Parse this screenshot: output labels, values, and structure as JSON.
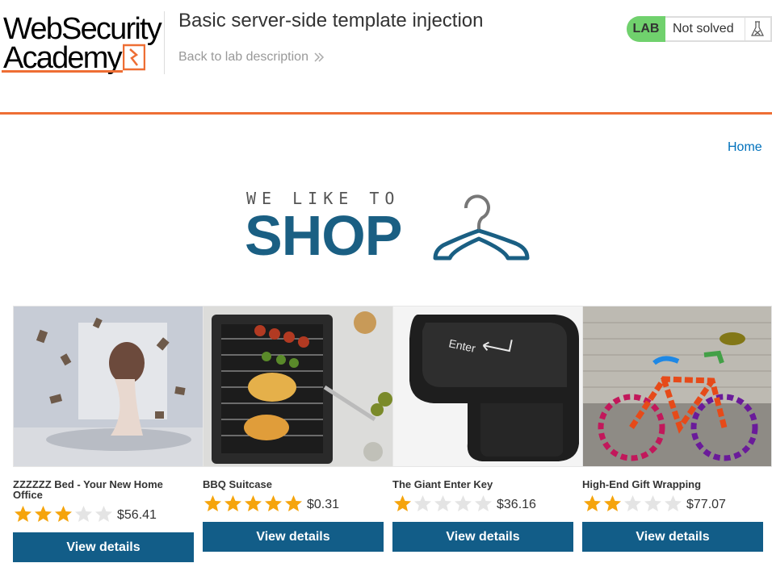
{
  "header": {
    "logo_line1": "WebSecurity",
    "logo_line2": "Academy",
    "lab_title": "Basic server-side template injection",
    "back_link": "Back to lab description",
    "status_badge": "LAB",
    "status_text": "Not solved"
  },
  "nav": {
    "home": "Home"
  },
  "banner": {
    "small": "WE LIKE TO",
    "big": "SHOP"
  },
  "products": [
    {
      "name": "ZZZZZZ Bed - Your New Home Office",
      "rating": 3,
      "price": "$56.41",
      "button": "View details"
    },
    {
      "name": "BBQ Suitcase",
      "rating": 5,
      "price": "$0.31",
      "button": "View details"
    },
    {
      "name": "The Giant Enter Key",
      "rating": 1,
      "price": "$36.16",
      "button": "View details"
    },
    {
      "name": "High-End Gift Wrapping",
      "rating": 2,
      "price": "$77.07",
      "button": "View details"
    }
  ],
  "colors": {
    "accent": "#ee6e34",
    "button": "#125d88",
    "link": "#0071bc",
    "lab_badge": "#70d16d",
    "star_on": "#f5a40c",
    "star_off": "#e4e4e4"
  }
}
